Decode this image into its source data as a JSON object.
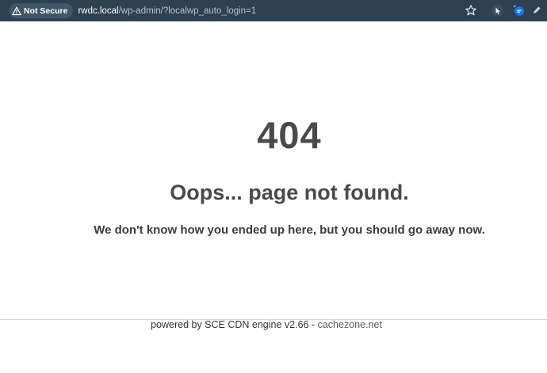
{
  "browser": {
    "security_label": "Not Secure",
    "url_host": "rwdc.local",
    "url_path": "/wp-admin/?localwp_auto_login=1",
    "icons": [
      "warning-triangle-icon",
      "bookmark-star-icon",
      "extension-cursor-icon",
      "extension-chat-icon",
      "extension-pen-icon"
    ]
  },
  "error_page": {
    "code": "404",
    "headline": "Oops... page not found.",
    "message": "We don't know how you ended up here, but you should go away now."
  },
  "footer": {
    "powered_by": "powered by SCE CDN engine v2.66 - ",
    "link_text": "cachezone.net"
  },
  "colors": {
    "toolbar_bg": "#2d4150",
    "text_dark": "#4a4a4a"
  }
}
